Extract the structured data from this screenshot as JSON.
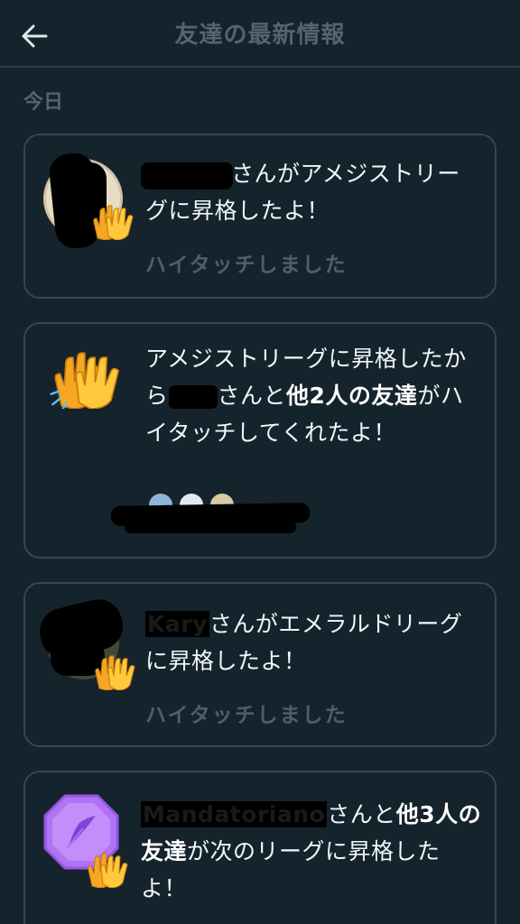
{
  "header": {
    "back_icon": "arrow-left-icon",
    "title": "友達の最新情報"
  },
  "section": {
    "label": "今日"
  },
  "feed": [
    {
      "name_redacted": true,
      "message": "さんがアメジストリーグに昇格したよ！",
      "action": "ハイタッチしました"
    },
    {
      "prefix": "アメジストリーグに昇格したから",
      "middle": "さんと",
      "bold1": "他2人の友達",
      "suffix": "がハイタッチしてくれたよ！"
    },
    {
      "name_visible": "Kary",
      "message": "さんがエメラルドリーグに昇格したよ！",
      "action": "ハイタッチしました"
    },
    {
      "name_visible": "Mandatoriano",
      "middle": "さんと",
      "bold1": "他3人の友達",
      "suffix": "が次のリーグに昇格したよ！"
    }
  ],
  "colors": {
    "background": "#15232c",
    "card_border": "#37464f",
    "muted_text": "#52656f",
    "amethyst": "#b172f5"
  }
}
